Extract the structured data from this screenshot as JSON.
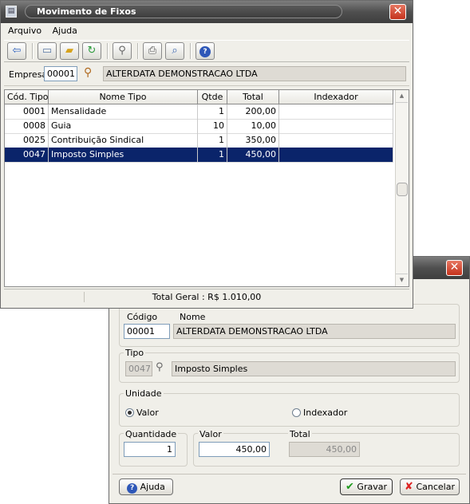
{
  "main_window": {
    "title": "Movimento de Fixos",
    "menu": {
      "arquivo": "Arquivo",
      "ajuda": "Ajuda"
    },
    "toolbar_icons": [
      "exit-icon",
      "new-document-icon",
      "open-folder-icon",
      "refresh-icon",
      "search-icon",
      "print-icon",
      "preview-icon",
      "help-icon"
    ],
    "empresa": {
      "label": "Empresa",
      "code": "00001",
      "name": "ALTERDATA DEMONSTRACAO LTDA"
    },
    "table": {
      "headers": [
        "Cód. Tipo",
        "Nome Tipo",
        "Qtde",
        "Total",
        "Indexador"
      ],
      "rows": [
        {
          "codigo": "0001",
          "nome": "Mensalidade",
          "qtde": "1",
          "total": "200,00",
          "indexador": ""
        },
        {
          "codigo": "0008",
          "nome": "Guia",
          "qtde": "10",
          "total": "10,00",
          "indexador": ""
        },
        {
          "codigo": "0025",
          "nome": "Contribuição Sindical",
          "qtde": "1",
          "total": "350,00",
          "indexador": ""
        },
        {
          "codigo": "0047",
          "nome": "Imposto Simples",
          "qtde": "1",
          "total": "450,00",
          "indexador": ""
        }
      ],
      "selected_row": 3
    },
    "status": "Total Geral : R$ 1.010,00"
  },
  "dialog": {
    "empresa_group": {
      "codigo_label": "Código",
      "nome_label": "Nome",
      "codigo": "00001",
      "nome": "ALTERDATA DEMONSTRACAO LTDA"
    },
    "tipo_group": {
      "label": "Tipo",
      "codigo": "0047",
      "nome": "Imposto Simples"
    },
    "unidade_group": {
      "label": "Unidade",
      "valor_option": "Valor",
      "indexador_option": "Indexador",
      "selected": "Valor"
    },
    "quantidade": {
      "label": "Quantidade",
      "value": "1"
    },
    "valor": {
      "label": "Valor",
      "value": "450,00"
    },
    "total": {
      "label": "Total",
      "value": "450,00"
    },
    "buttons": {
      "ajuda": "Ajuda",
      "gravar": "Gravar",
      "cancelar": "Cancelar"
    }
  }
}
